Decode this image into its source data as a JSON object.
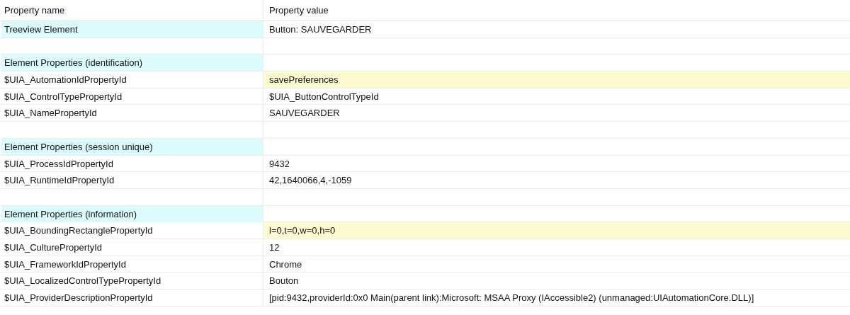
{
  "columns": [
    "Property name",
    "Property value"
  ],
  "rows": [
    {
      "kind": "header",
      "name": "Treeview Element",
      "value": "Button: SAUVEGARDER",
      "highlighted": false
    },
    {
      "kind": "blank"
    },
    {
      "kind": "header",
      "name": "Element Properties (identification)"
    },
    {
      "kind": "property",
      "name": "$UIA_AutomationIdPropertyId",
      "value": "savePreferences",
      "highlighted": true
    },
    {
      "kind": "property",
      "name": "$UIA_ControlTypePropertyId",
      "value": "$UIA_ButtonControlTypeId",
      "highlighted": false
    },
    {
      "kind": "property",
      "name": "$UIA_NamePropertyId",
      "value": "SAUVEGARDER",
      "highlighted": false
    },
    {
      "kind": "blank"
    },
    {
      "kind": "header",
      "name": "Element Properties (session unique)"
    },
    {
      "kind": "property",
      "name": "$UIA_ProcessIdPropertyId",
      "value": "9432",
      "highlighted": false
    },
    {
      "kind": "property",
      "name": "$UIA_RuntimeIdPropertyId",
      "value": "42,1640066,4,-1059",
      "highlighted": false
    },
    {
      "kind": "blank"
    },
    {
      "kind": "header",
      "name": "Element Properties (information)"
    },
    {
      "kind": "property",
      "name": "$UIA_BoundingRectanglePropertyId",
      "value": "l=0,t=0,w=0,h=0",
      "highlighted": true
    },
    {
      "kind": "property",
      "name": "$UIA_CulturePropertyId",
      "value": "12",
      "highlighted": false
    },
    {
      "kind": "property",
      "name": "$UIA_FrameworkIdPropertyId",
      "value": "Chrome",
      "highlighted": false
    },
    {
      "kind": "property",
      "name": "$UIA_LocalizedControlTypePropertyId",
      "value": "Bouton",
      "highlighted": false
    },
    {
      "kind": "property",
      "name": "$UIA_ProviderDescriptionPropertyId",
      "value": "[pid:9432,providerId:0x0 Main(parent link):Microsoft: MSAA Proxy (IAccessible2) (unmanaged:UIAutomationCore.DLL)]",
      "highlighted": false
    }
  ]
}
